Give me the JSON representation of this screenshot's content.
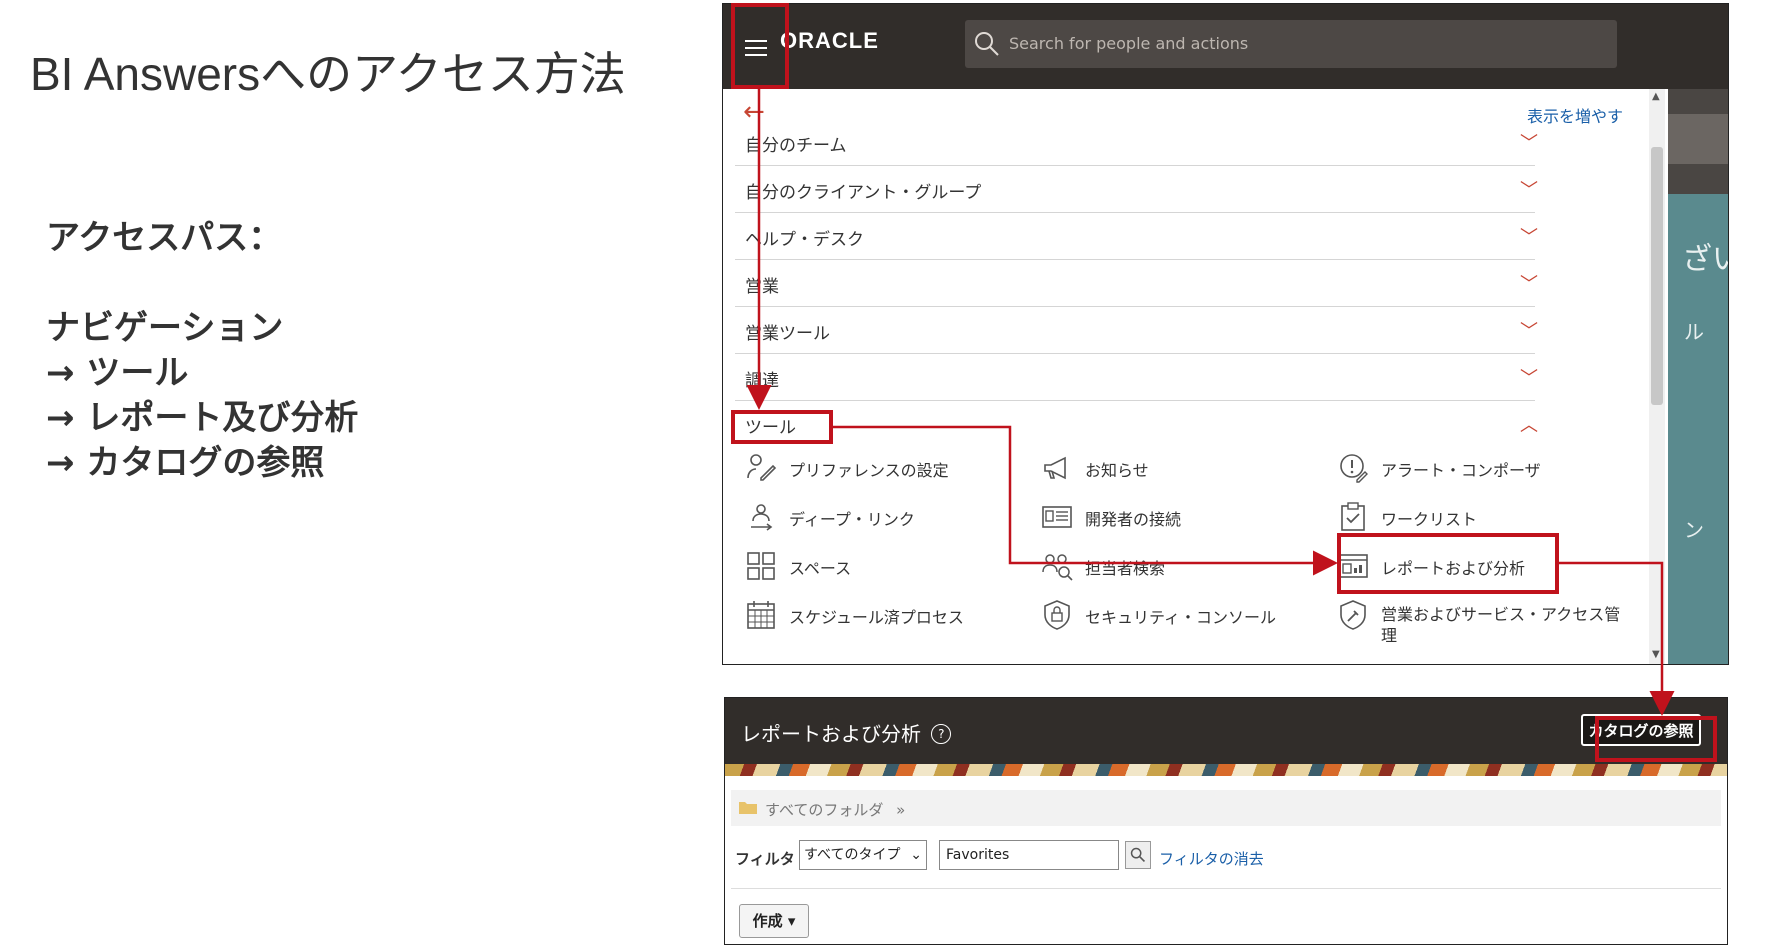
{
  "slide": {
    "title": "BI Answersへのアクセス方法",
    "access_path_heading": "アクセスパス：",
    "path_steps": [
      "ナビゲーション",
      "→ ツール",
      "→ レポート及び分析",
      "→ カタログの参照"
    ]
  },
  "oracle_header": {
    "logo_text": "ORACLE",
    "search_placeholder": "Search for people and actions"
  },
  "nav_menu": {
    "show_more": "表示を増やす",
    "sections": [
      {
        "label": "自分のチーム",
        "expanded": false
      },
      {
        "label": "自分のクライアント・グループ",
        "expanded": false
      },
      {
        "label": "ヘルプ・デスク",
        "expanded": false
      },
      {
        "label": "営業",
        "expanded": false
      },
      {
        "label": "営業ツール",
        "expanded": false
      },
      {
        "label": "調達",
        "expanded": false
      },
      {
        "label": "ツール",
        "expanded": true
      }
    ],
    "tools": [
      {
        "label": "プリファレンスの設定",
        "icon": "preferences-icon"
      },
      {
        "label": "お知らせ",
        "icon": "megaphone-icon"
      },
      {
        "label": "アラート・コンポーザ",
        "icon": "alert-composer-icon"
      },
      {
        "label": "ディープ・リンク",
        "icon": "deep-link-icon"
      },
      {
        "label": "開発者の接続",
        "icon": "developer-connect-icon"
      },
      {
        "label": "ワークリスト",
        "icon": "worklist-icon"
      },
      {
        "label": "スペース",
        "icon": "spaces-icon"
      },
      {
        "label": "担当者検索",
        "icon": "people-search-icon"
      },
      {
        "label": "レポートおよび分析",
        "icon": "reports-icon"
      },
      {
        "label": "スケジュール済プロセス",
        "icon": "calendar-icon"
      },
      {
        "label": "セキュリティ・コンソール",
        "icon": "security-shield-icon"
      },
      {
        "label": "営業およびサービス・アクセス管理",
        "icon": "access-management-icon"
      }
    ]
  },
  "background_fragments": {
    "top": "ざい",
    "mid": "ル",
    "low": "ン"
  },
  "reports_page": {
    "title": "レポートおよび分析",
    "help_glyph": "?",
    "browse_catalog": "カタログの参照",
    "breadcrumb": "すべてのフォルダ",
    "breadcrumb_sep": "»",
    "filter_label": "フィルタ",
    "type_select_value": "すべてのタイプ",
    "filter_value": "Favorites",
    "clear_filter": "フィルタの消去",
    "create_button": "作成 ▾"
  },
  "colors": {
    "oracle_header_bg": "#312d2a",
    "highlight_red": "#c0121c",
    "accent_red": "#c74634",
    "link_blue": "#1a5fa8"
  }
}
